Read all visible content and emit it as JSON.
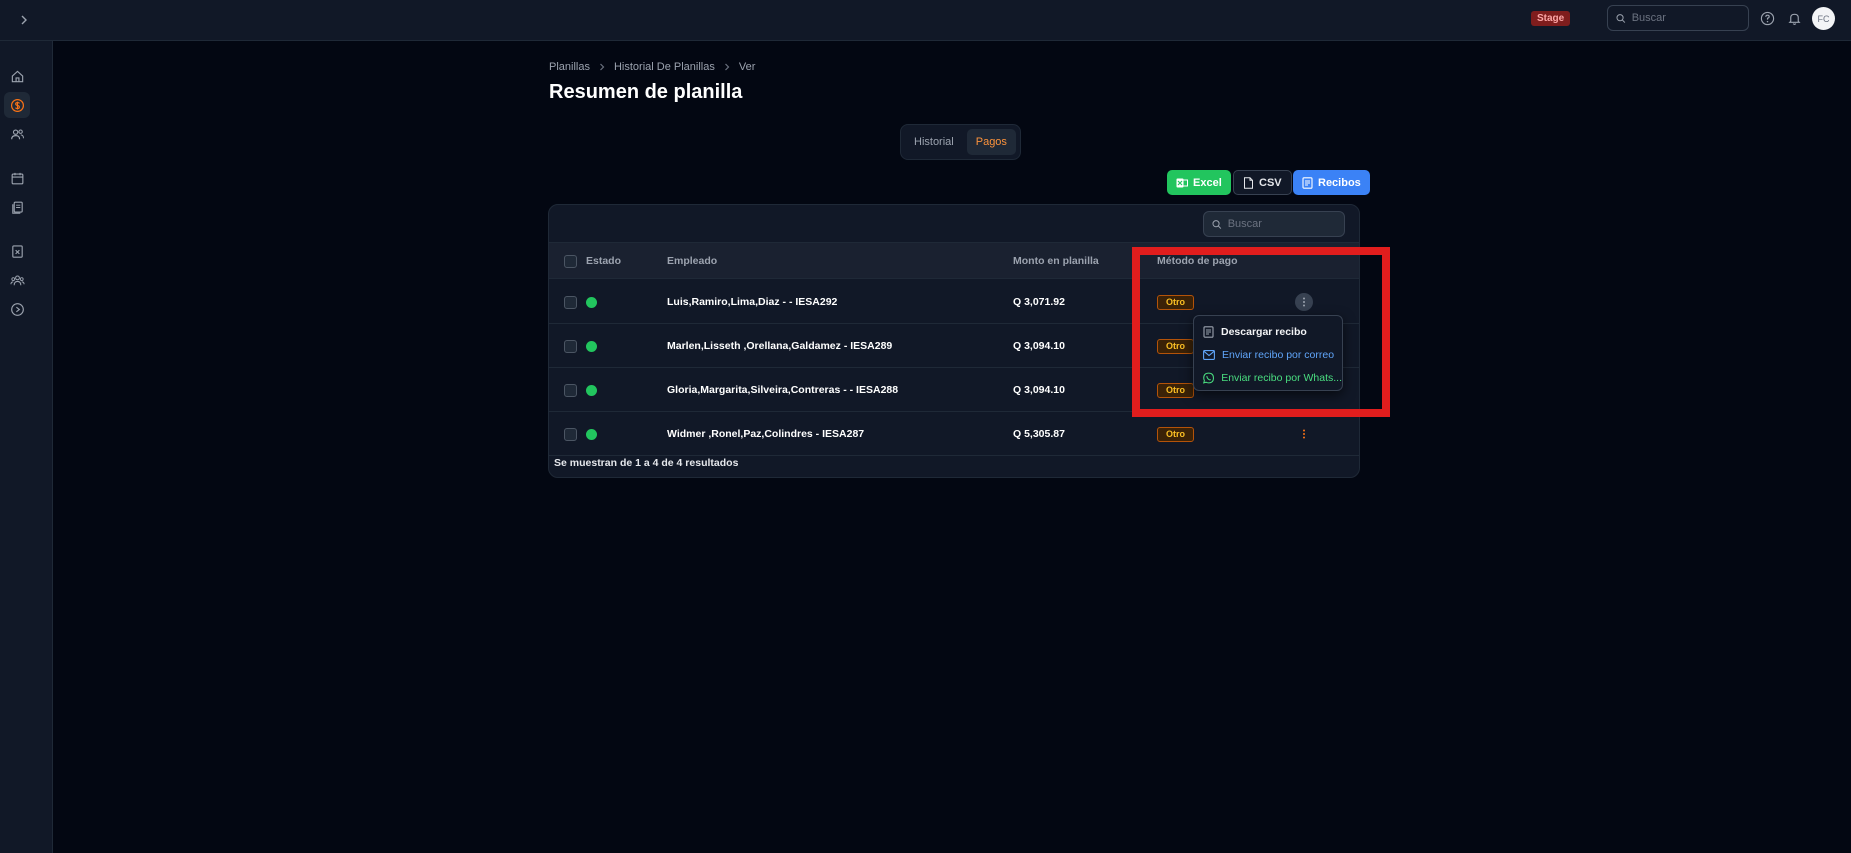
{
  "topbar": {
    "env_badge": "Stage",
    "search_placeholder": "Buscar",
    "avatar_initials": "FC"
  },
  "sidebar": {
    "items": [
      {
        "icon": "home-icon",
        "active": false
      },
      {
        "icon": "dollar-icon",
        "active": true
      },
      {
        "icon": "users-icon",
        "active": false
      },
      {
        "icon": "calendar-icon",
        "active": false
      },
      {
        "icon": "documents-icon",
        "active": false
      },
      {
        "icon": "file-x-icon",
        "active": false
      },
      {
        "icon": "team-icon",
        "active": false
      },
      {
        "icon": "play-circle-icon",
        "active": false
      }
    ]
  },
  "breadcrumb": {
    "items": [
      "Planillas",
      "Historial De Planillas",
      "Ver"
    ]
  },
  "page": {
    "title": "Resumen de planilla"
  },
  "tabs": [
    {
      "label": "Historial",
      "active": false
    },
    {
      "label": "Pagos",
      "active": true
    }
  ],
  "actions": {
    "excel": "Excel",
    "csv": "CSV",
    "recibos": "Recibos"
  },
  "table": {
    "search_placeholder": "Buscar",
    "columns": {
      "estado": "Estado",
      "empleado": "Empleado",
      "monto": "Monto en planilla",
      "metodo": "Método de pago"
    },
    "rows": [
      {
        "empleado": "Luis,Ramiro,Lima,Diaz - - IESA292",
        "monto": "Q 3,071.92",
        "metodo": "Otro",
        "status_color": "#22c55e"
      },
      {
        "empleado": "Marlen,Lisseth ,Orellana,Galdamez - IESA289",
        "monto": "Q 3,094.10",
        "metodo": "Otro",
        "status_color": "#22c55e"
      },
      {
        "empleado": "Gloria,Margarita,Silveira,Contreras - - IESA288",
        "monto": "Q 3,094.10",
        "metodo": "Otro",
        "status_color": "#22c55e"
      },
      {
        "empleado": "Widmer ,Ronel,Paz,Colindres - IESA287",
        "monto": "Q 5,305.87",
        "metodo": "Otro",
        "status_color": "#22c55e"
      }
    ],
    "footer": "Se muestran de 1 a 4 de 4 resultados"
  },
  "row_menu": {
    "download": "Descargar recibo",
    "email": "Enviar recibo por correo",
    "whatsapp": "Enviar recibo por Whats..."
  },
  "colors": {
    "accent": "#f97316",
    "excel": "#22c55e",
    "recibos": "#3b82f6",
    "highlight": "#e11d1d"
  }
}
